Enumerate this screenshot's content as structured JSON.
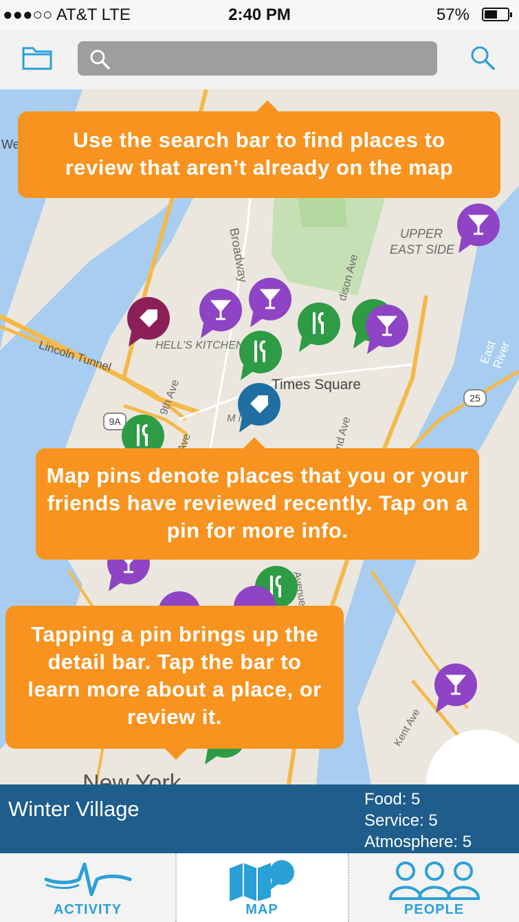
{
  "status_bar": {
    "carrier": "●●●○○ AT&T  LTE",
    "time": "2:40 PM",
    "battery": "57%",
    "battery_level": 0.57
  },
  "search": {
    "placeholder": ""
  },
  "map": {
    "labels": {
      "broadway": "Broadway",
      "upper_east_side_1": "UPPER",
      "upper_east_side_2": "EAST SIDE",
      "hells_kitchen": "HELL'S KITCHEN",
      "lincoln_tunnel": "Lincoln Tunnel",
      "times_square": "Times Square",
      "ninth_ave": "9th Ave",
      "tenth_ave": "th Ave",
      "east_river": "East River",
      "madison_ave": "dison Ave",
      "second_ave": "2nd Ave",
      "kent_ave": "Kent Ave",
      "new_york": "New York",
      "route_9a": "9A",
      "route_25": "25",
      "midtown": "M    N",
      "we": "We",
      "avenue": "Avenue"
    }
  },
  "tooltips": {
    "search": "Use the search bar to find places to review that aren’t already on the map",
    "pins": "Map pins denote places that you or your friends have reviewed recently. Tap on a pin for more info.",
    "detail": "Tapping a pin brings up the detail bar. Tap the bar to learn more about a place, or review it."
  },
  "detail_bar": {
    "name": "Winter Village",
    "food": "Food: 5",
    "service": "Service: 5",
    "atmosphere": "Atmosphere: 5"
  },
  "tabs": {
    "activity": "ACTIVITY",
    "map": "MAP",
    "people": "PEOPLE"
  },
  "colors": {
    "accent": "#2aa0d8",
    "tooltip": "#f7931e",
    "detail_bar": "#1e5d8c",
    "pin_bar": "#8e44c4",
    "pin_food": "#2e9b45",
    "pin_shop_maroon": "#8c1f57",
    "pin_shop_blue": "#1f6fa3"
  }
}
